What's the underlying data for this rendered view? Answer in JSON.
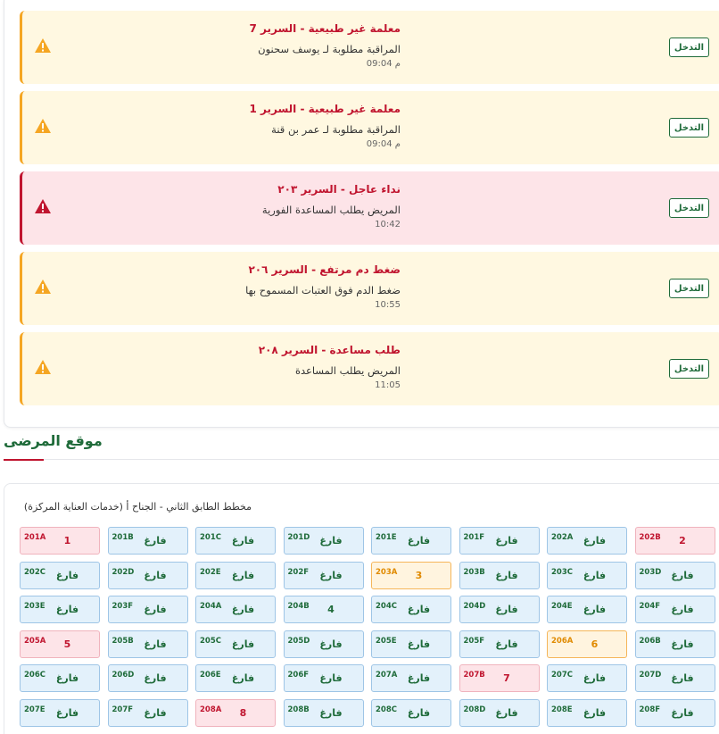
{
  "alerts": [
    {
      "title": "معلمة غير طبيعية - السرير 7",
      "message": "المراقبة مطلوبة لـ يوسف سحنون",
      "time": "م 09:04",
      "level": "warning",
      "action": "التدخل"
    },
    {
      "title": "معلمة غير طبيعية - السرير 1",
      "message": "المراقبة مطلوبة لـ عمر بن قنة",
      "time": "م 09:04",
      "level": "warning",
      "action": "التدخل"
    },
    {
      "title": "نداء عاجل - السرير ٢٠٣",
      "message": "المريض يطلب المساعدة الفورية",
      "time": "10:42",
      "level": "danger",
      "action": "التدخل"
    },
    {
      "title": "ضغط دم مرتفع - السرير ٢٠٦",
      "message": "ضغط الدم فوق العتبات المسموح بها",
      "time": "10:55",
      "level": "warning",
      "action": "التدخل"
    },
    {
      "title": "طلب مساعدة - السرير ٢٠٨",
      "message": "المريض يطلب المساعدة",
      "time": "11:05",
      "level": "warning",
      "action": "التدخل"
    }
  ],
  "section": {
    "title": "موقع المرضى"
  },
  "map": {
    "caption": "مخطط الطابق الثاني - الجناح أ (خدمات العناية المركزة)",
    "beds": [
      {
        "id": "201A",
        "status": "1",
        "state": "red"
      },
      {
        "id": "201B",
        "status": "فارغ",
        "state": "empty"
      },
      {
        "id": "201C",
        "status": "فارغ",
        "state": "empty"
      },
      {
        "id": "201D",
        "status": "فارغ",
        "state": "empty"
      },
      {
        "id": "201E",
        "status": "فارغ",
        "state": "empty"
      },
      {
        "id": "201F",
        "status": "فارغ",
        "state": "empty"
      },
      {
        "id": "202A",
        "status": "فارغ",
        "state": "empty"
      },
      {
        "id": "202B",
        "status": "2",
        "state": "red"
      },
      {
        "id": "202C",
        "status": "فارغ",
        "state": "empty"
      },
      {
        "id": "202D",
        "status": "فارغ",
        "state": "empty"
      },
      {
        "id": "202E",
        "status": "فارغ",
        "state": "empty"
      },
      {
        "id": "202F",
        "status": "فارغ",
        "state": "empty"
      },
      {
        "id": "203A",
        "status": "3",
        "state": "orange"
      },
      {
        "id": "203B",
        "status": "فارغ",
        "state": "empty"
      },
      {
        "id": "203C",
        "status": "فارغ",
        "state": "empty"
      },
      {
        "id": "203D",
        "status": "فارغ",
        "state": "empty"
      },
      {
        "id": "203E",
        "status": "فارغ",
        "state": "empty"
      },
      {
        "id": "203F",
        "status": "فارغ",
        "state": "empty"
      },
      {
        "id": "204A",
        "status": "فارغ",
        "state": "empty"
      },
      {
        "id": "204B",
        "status": "4",
        "state": "empty"
      },
      {
        "id": "204C",
        "status": "فارغ",
        "state": "empty"
      },
      {
        "id": "204D",
        "status": "فارغ",
        "state": "empty"
      },
      {
        "id": "204E",
        "status": "فارغ",
        "state": "empty"
      },
      {
        "id": "204F",
        "status": "فارغ",
        "state": "empty"
      },
      {
        "id": "205A",
        "status": "5",
        "state": "red"
      },
      {
        "id": "205B",
        "status": "فارغ",
        "state": "empty"
      },
      {
        "id": "205C",
        "status": "فارغ",
        "state": "empty"
      },
      {
        "id": "205D",
        "status": "فارغ",
        "state": "empty"
      },
      {
        "id": "205E",
        "status": "فارغ",
        "state": "empty"
      },
      {
        "id": "205F",
        "status": "فارغ",
        "state": "empty"
      },
      {
        "id": "206A",
        "status": "6",
        "state": "orange"
      },
      {
        "id": "206B",
        "status": "فارغ",
        "state": "empty"
      },
      {
        "id": "206C",
        "status": "فارغ",
        "state": "empty"
      },
      {
        "id": "206D",
        "status": "فارغ",
        "state": "empty"
      },
      {
        "id": "206E",
        "status": "فارغ",
        "state": "empty"
      },
      {
        "id": "206F",
        "status": "فارغ",
        "state": "empty"
      },
      {
        "id": "207A",
        "status": "فارغ",
        "state": "empty"
      },
      {
        "id": "207B",
        "status": "7",
        "state": "red"
      },
      {
        "id": "207C",
        "status": "فارغ",
        "state": "empty"
      },
      {
        "id": "207D",
        "status": "فارغ",
        "state": "empty"
      },
      {
        "id": "207E",
        "status": "فارغ",
        "state": "empty"
      },
      {
        "id": "207F",
        "status": "فارغ",
        "state": "empty"
      },
      {
        "id": "208A",
        "status": "8",
        "state": "red"
      },
      {
        "id": "208B",
        "status": "فارغ",
        "state": "empty"
      },
      {
        "id": "208C",
        "status": "فارغ",
        "state": "empty"
      },
      {
        "id": "208D",
        "status": "فارغ",
        "state": "empty"
      },
      {
        "id": "208E",
        "status": "فارغ",
        "state": "empty"
      },
      {
        "id": "208F",
        "status": "فارغ",
        "state": "empty"
      }
    ]
  },
  "colors": {
    "primary": "#1f6b3a",
    "danger": "#c0152f",
    "warning": "#f5a623"
  },
  "icons": {
    "alert": "warning-triangle-icon"
  }
}
